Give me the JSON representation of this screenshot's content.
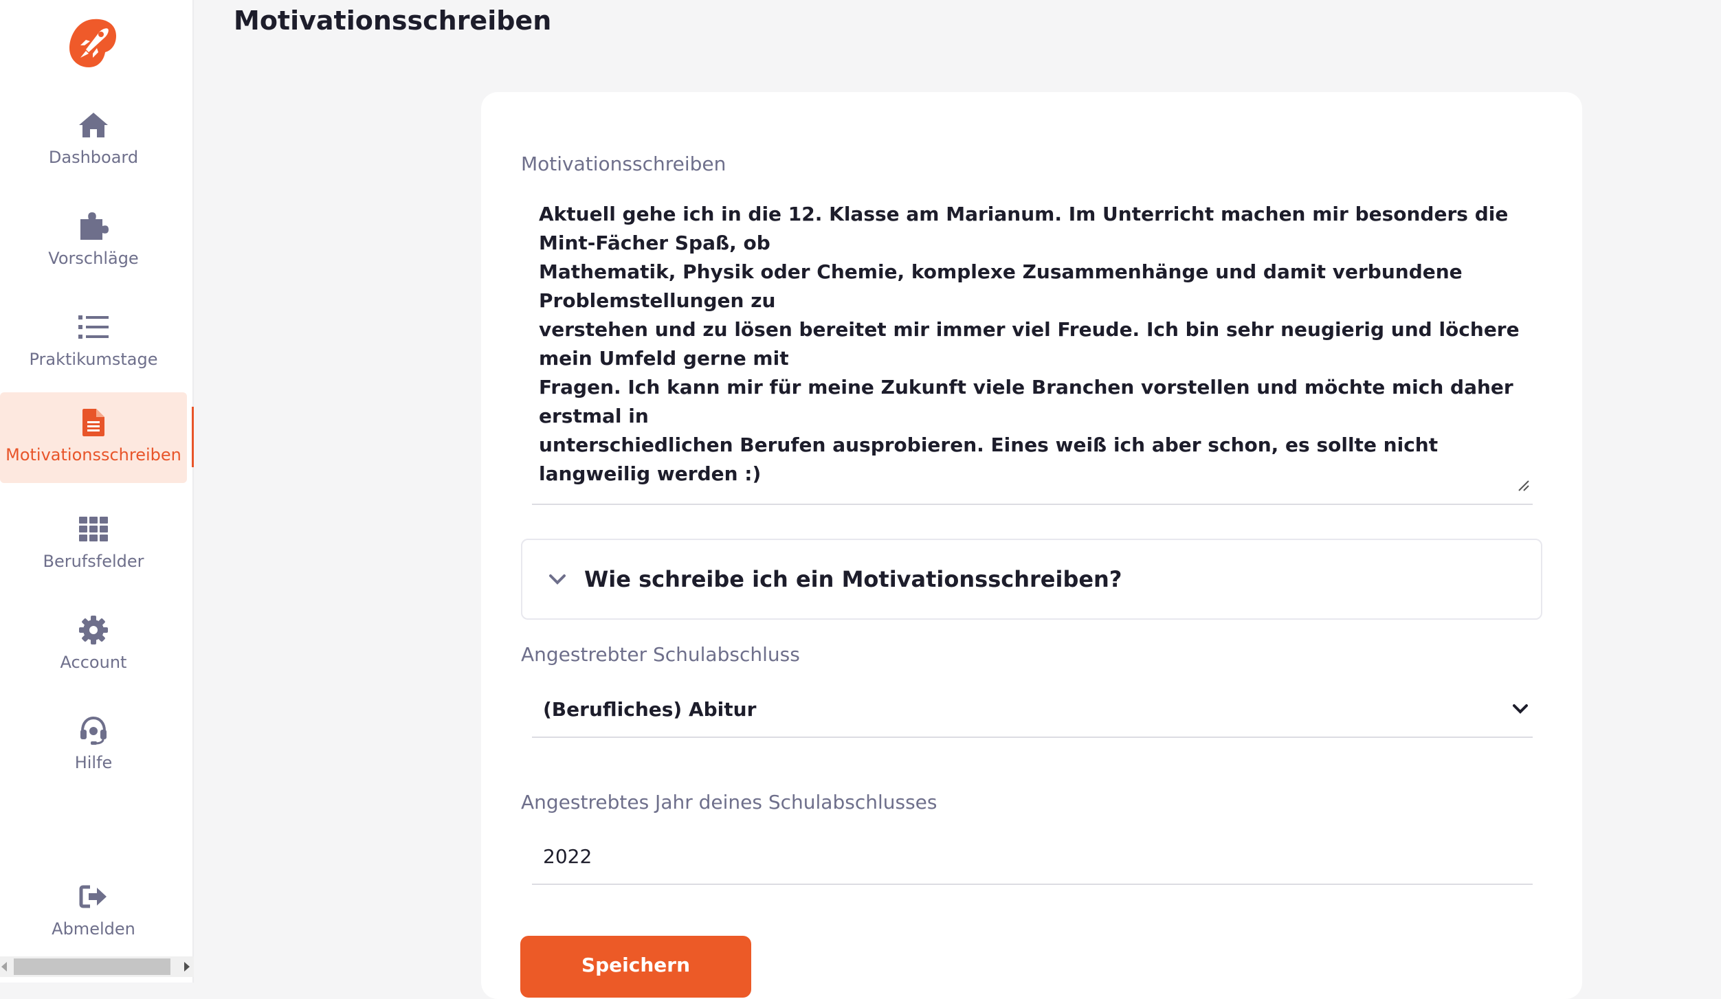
{
  "colors": {
    "accent": "#e8552a",
    "nav": "#6e6f8b",
    "active_bg": "#fde8df",
    "text": "#1d1d2b"
  },
  "sidebar": {
    "logo": "rocket-logo-icon",
    "items": [
      {
        "label": "Dashboard",
        "icon": "home-icon",
        "active": false
      },
      {
        "label": "Vorschläge",
        "icon": "puzzle-icon",
        "active": false
      },
      {
        "label": "Praktikumstage",
        "icon": "list-icon",
        "active": false
      },
      {
        "label": "Motivationsschreiben",
        "icon": "document-icon",
        "active": true
      },
      {
        "label": "Berufsfelder",
        "icon": "grid-icon",
        "active": false
      },
      {
        "label": "Account",
        "icon": "gear-icon",
        "active": false
      },
      {
        "label": "Hilfe",
        "icon": "headset-icon",
        "active": false
      }
    ],
    "logout": {
      "label": "Abmelden",
      "icon": "logout-icon"
    }
  },
  "page": {
    "title": "Motivationsschreiben"
  },
  "form": {
    "letter": {
      "label": "Motivationsschreiben",
      "value": "Aktuell gehe ich in die 12. Klasse am Marianum. Im Unterricht machen mir besonders die Mint-Fächer Spaß, ob\nMathematik, Physik oder Chemie, komplexe Zusammenhänge und damit verbundene Problemstellungen zu\nverstehen und zu lösen bereitet mir immer viel Freude. Ich bin sehr neugierig und löchere mein Umfeld gerne mit\nFragen. Ich kann mir für meine Zukunft viele Branchen vorstellen und möchte mich daher erstmal in\nunterschiedlichen Berufen ausprobieren. Eines weiß ich aber schon, es sollte nicht langweilig werden :)"
    },
    "help_accordion": {
      "title": "Wie schreibe ich ein Motivationsschreiben?",
      "expanded": false
    },
    "degree": {
      "label": "Angestrebter Schulabschluss",
      "value": "(Berufliches) Abitur"
    },
    "year": {
      "label": "Angestrebtes Jahr deines Schulabschlusses",
      "value": "2022"
    },
    "save_label": "Speichern"
  }
}
